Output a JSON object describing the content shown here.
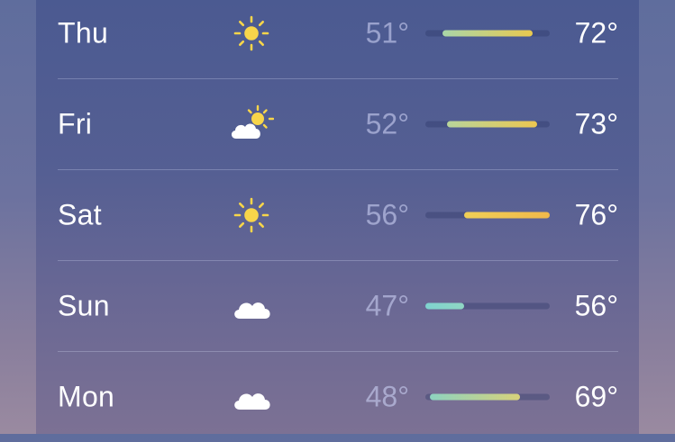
{
  "scale": {
    "min": 47,
    "max": 76
  },
  "forecast": [
    {
      "day": "Thu",
      "icon": "sun-icon",
      "low": "51°",
      "high": "72°",
      "low_value": 51,
      "high_value": 72,
      "bar_colors": [
        "#a9d6a8",
        "#e9c94f"
      ]
    },
    {
      "day": "Fri",
      "icon": "partly-cloudy-icon",
      "low": "52°",
      "high": "73°",
      "low_value": 52,
      "high_value": 73,
      "bar_colors": [
        "#b8d59b",
        "#ecc750"
      ]
    },
    {
      "day": "Sat",
      "icon": "sun-icon",
      "low": "56°",
      "high": "76°",
      "low_value": 56,
      "high_value": 76,
      "bar_colors": [
        "#f0cf56",
        "#f0b84a"
      ]
    },
    {
      "day": "Sun",
      "icon": "cloud-icon",
      "low": "47°",
      "high": "56°",
      "low_value": 47,
      "high_value": 56,
      "bar_colors": [
        "#7fd3cf",
        "#8fd6c3"
      ]
    },
    {
      "day": "Mon",
      "icon": "cloud-icon",
      "low": "48°",
      "high": "69°",
      "low_value": 48,
      "high_value": 69,
      "bar_colors": [
        "#8dd3c0",
        "#d8d27a"
      ]
    }
  ],
  "colors": {
    "sun": "#f7d54a",
    "cloud": "#ffffff"
  }
}
